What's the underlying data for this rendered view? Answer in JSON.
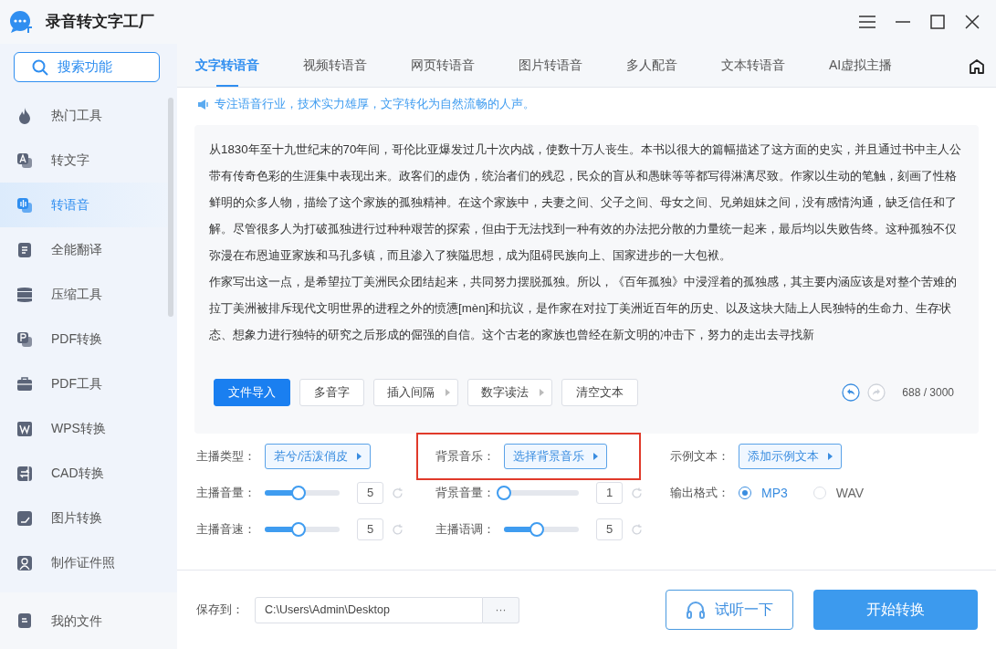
{
  "window": {
    "title": "录音转文字工厂"
  },
  "search_button": {
    "label": "搜索功能"
  },
  "sidebar": {
    "items": [
      {
        "label": "热门工具",
        "selected": false
      },
      {
        "label": "转文字",
        "selected": false
      },
      {
        "label": "转语音",
        "selected": true
      },
      {
        "label": "全能翻译",
        "selected": false
      },
      {
        "label": "压缩工具",
        "selected": false
      },
      {
        "label": "PDF转换",
        "selected": false
      },
      {
        "label": "PDF工具",
        "selected": false
      },
      {
        "label": "WPS转换",
        "selected": false
      },
      {
        "label": "CAD转换",
        "selected": false
      },
      {
        "label": "图片转换",
        "selected": false
      },
      {
        "label": "制作证件照",
        "selected": false
      }
    ],
    "footer": {
      "label": "我的文件"
    }
  },
  "tabs": [
    {
      "label": "文字转语音",
      "selected": true
    },
    {
      "label": "视频转语音",
      "selected": false
    },
    {
      "label": "网页转语音",
      "selected": false
    },
    {
      "label": "图片转语音",
      "selected": false
    },
    {
      "label": "多人配音",
      "selected": false
    },
    {
      "label": "文本转语音",
      "selected": false
    },
    {
      "label": "AI虚拟主播",
      "selected": false
    }
  ],
  "notice": "专注语音行业，技术实力雄厚，文字转化为自然流畅的人声。",
  "editor": {
    "paragraphs": [
      "从1830年至十九世纪末的70年间，哥伦比亚爆发过几十次内战，使数十万人丧生。本书以很大的篇幅描述了这方面的史实，并且通过书中主人公带有传奇色彩的生涯集中表现出来。政客们的虚伪，统治者们的残忍，民众的盲从和愚昧等等都写得淋漓尽致。作家以生动的笔触，刻画了性格鲜明的众多人物，描绘了这个家族的孤独精神。在这个家族中，夫妻之间、父子之间、母女之间、兄弟姐妹之间，没有感情沟通，缺乏信任和了解。尽管很多人为打破孤独进行过种种艰苦的探索，但由于无法找到一种有效的办法把分散的力量统一起来，最后均以失败告终。这种孤独不仅弥漫在布恩迪亚家族和马孔多镇，而且渗入了狭隘思想，成为阻碍民族向上、国家进步的一大包袱。",
      "作家写出这一点，是希望拉丁美洲民众团结起来，共同努力摆脱孤独。所以，《百年孤独》中浸淫着的孤独感，其主要内涵应该是对整个苦难的拉丁美洲被排斥现代文明世界的进程之外的愤懑[mèn]和抗议，是作家在对拉丁美洲近百年的历史、以及这块大陆上人民独特的生命力、生存状态、想象力进行独特的研究之后形成的倔强的自信。这个古老的家族也曾经在新文明的冲击下，努力的走出去寻找新"
    ],
    "tools": [
      {
        "label": "文件导入",
        "kind": "primary"
      },
      {
        "label": "多音字",
        "kind": "plain"
      },
      {
        "label": "插入间隔",
        "kind": "menu"
      },
      {
        "label": "数字读法",
        "kind": "menu"
      },
      {
        "label": "清空文本",
        "kind": "plain"
      }
    ],
    "undo": {
      "disabled": false
    },
    "redo": {
      "disabled": true
    },
    "count": "688 / 3000"
  },
  "settings": [
    {
      "kind": "select",
      "label": "主播类型：",
      "value": "若兮/活泼俏皮"
    },
    {
      "kind": "select",
      "label": "背景音乐：",
      "value": "选择背景音乐",
      "highlighted": true
    },
    {
      "kind": "select",
      "label": "示例文本：",
      "value": "添加示例文本"
    },
    {
      "kind": "slider",
      "label": "主播音量：",
      "level": 0.45,
      "value": "5"
    },
    {
      "kind": "slider",
      "label": "背景音量：",
      "level": 0,
      "value": "1"
    },
    {
      "kind": "radio",
      "label": "输出格式：",
      "options": [
        {
          "label": "MP3",
          "selected": true
        },
        {
          "label": "WAV",
          "selected": false
        }
      ]
    },
    {
      "kind": "slider",
      "label": "主播音速：",
      "level": 0.45,
      "value": "5"
    },
    {
      "kind": "slider",
      "label": "主播语调：",
      "level": 0.44,
      "value": "5"
    }
  ],
  "save": {
    "label": "保存到：",
    "path": "C:\\Users\\Admin\\Desktop",
    "browse": "···"
  },
  "preview_button": "试听一下",
  "start_button": "开始转换"
}
